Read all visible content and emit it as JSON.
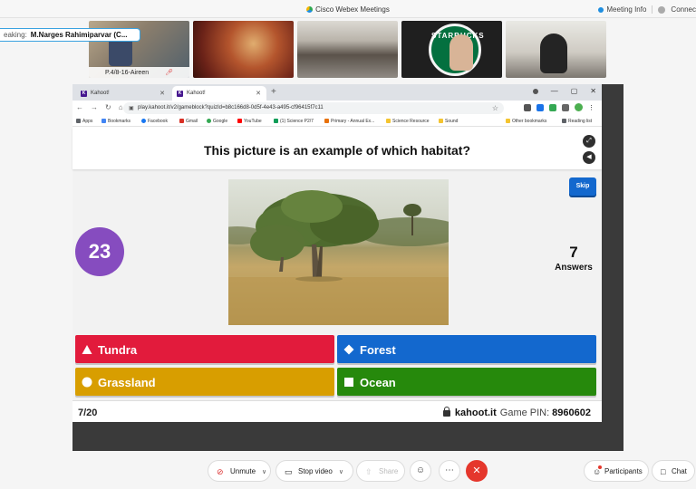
{
  "titlebar": {
    "app_title": "Cisco Webex Meetings",
    "meeting_info": "Meeting Info",
    "connection": "Connec"
  },
  "participants": {
    "speaking_label": "eaking:",
    "speaking_name": "M.Narges Rahimiparvar (C...",
    "tile1_name": "P.4/8-16-Aireen"
  },
  "browser": {
    "tabs": [
      {
        "label": "Kahoot!"
      },
      {
        "label": "Kahoot!"
      }
    ],
    "url": "play.kahoot.it/v2/gameblock?quizId=b8c166d8-0d5f-4e43-a495-cf96415f7c11",
    "bookmarks": [
      "Apps",
      "Bookmarks",
      "Facebook",
      "Gmail",
      "Google",
      "YouTube",
      "(1) Science P2/7",
      "Primary - Annual Ex...",
      "Science Resource",
      "Sound",
      "Other bookmarks",
      "Reading list"
    ]
  },
  "kahoot": {
    "question": "This picture is an example of which habitat?",
    "timer": "23",
    "skip_label": "Skip",
    "answers_count": "7",
    "answers_label": "Answers",
    "options": [
      {
        "label": "Tundra",
        "shape": "triangle",
        "color": "#e21b3c"
      },
      {
        "label": "Forest",
        "shape": "diamond",
        "color": "#1368ce"
      },
      {
        "label": "Grassland",
        "shape": "circle",
        "color": "#d89e00"
      },
      {
        "label": "Ocean",
        "shape": "square",
        "color": "#26890c"
      }
    ],
    "progress": "7/20",
    "site": "kahoot.it",
    "pin_label": "Game PIN:",
    "pin_value": "8960602"
  },
  "controls": {
    "unmute": "Unmute",
    "stop_video": "Stop video",
    "share": "Share",
    "participants": "Participants",
    "chat": "Chat"
  },
  "colors": {
    "kahoot_purple": "#864cbf",
    "leave_red": "#e5372c",
    "skip_blue": "#1368ce"
  }
}
